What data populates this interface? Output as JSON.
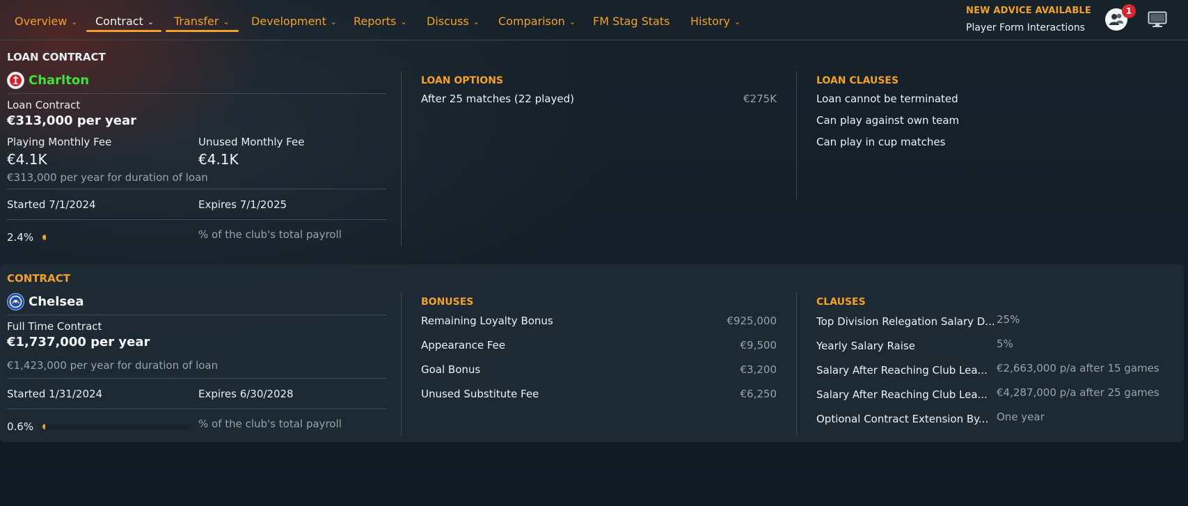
{
  "nav": {
    "items": [
      {
        "label": "Overview",
        "chevron": true
      },
      {
        "label": "Contract",
        "chevron": true
      },
      {
        "label": "Transfer",
        "chevron": true
      },
      {
        "label": "Development",
        "chevron": true
      },
      {
        "label": "Reports",
        "chevron": true
      },
      {
        "label": "Discuss",
        "chevron": true
      },
      {
        "label": "Comparison",
        "chevron": true
      },
      {
        "label": "FM Stag Stats",
        "chevron": false
      },
      {
        "label": "History",
        "chevron": true
      }
    ],
    "active": "Contract"
  },
  "advice": {
    "title": "NEW ADVICE AVAILABLE",
    "subtitle": "Player Form Interactions",
    "badge_count": "1"
  },
  "loan": {
    "section_title": "LOAN CONTRACT",
    "club": "Charlton",
    "contract_type": "Loan Contract",
    "salary": "€313,000 per year",
    "playing_fee_label": "Playing Monthly Fee",
    "playing_fee_value": "€4.1K",
    "unused_fee_label": "Unused Monthly Fee",
    "unused_fee_value": "€4.1K",
    "duration_note": "€313,000 per year for duration of loan",
    "started": "Started 7/1/2024",
    "expires": "Expires 7/1/2025",
    "payroll_pct": "2.4%",
    "payroll_fraction": 0.024,
    "payroll_label": "% of the club's total payroll",
    "options_title": "LOAN OPTIONS",
    "options": [
      {
        "label": "After 25 matches (22 played)",
        "value": "€275K"
      }
    ],
    "clauses_title": "LOAN CLAUSES",
    "clauses": [
      "Loan cannot be terminated",
      "Can play against own team",
      "Can play in cup matches"
    ]
  },
  "contract": {
    "section_title": "CONTRACT",
    "club": "Chelsea",
    "contract_type": "Full Time Contract",
    "salary": "€1,737,000 per year",
    "duration_note": "€1,423,000 per year for duration of loan",
    "started": "Started 1/31/2024",
    "expires": "Expires 6/30/2028",
    "payroll_pct": "0.6%",
    "payroll_fraction": 0.006,
    "payroll_label": "% of the club's total payroll",
    "bonuses_title": "BONUSES",
    "bonuses": [
      {
        "label": "Remaining Loyalty Bonus",
        "value": "€925,000"
      },
      {
        "label": "Appearance Fee",
        "value": "€9,500"
      },
      {
        "label": "Goal Bonus",
        "value": "€3,200"
      },
      {
        "label": "Unused Substitute Fee",
        "value": "€6,250"
      }
    ],
    "clauses_title": "CLAUSES",
    "clauses": [
      {
        "label": "Top Division Relegation Salary D...",
        "value": "25%"
      },
      {
        "label": "Yearly Salary Raise",
        "value": "5%"
      },
      {
        "label": "Salary After Reaching Club Lea...",
        "value": "€2,663,000 p/a after 15 games"
      },
      {
        "label": "Salary After Reaching Club Lea...",
        "value": "€4,287,000 p/a after 25 games"
      },
      {
        "label": "Optional Contract Extension By...",
        "value": "One year"
      }
    ]
  },
  "colors": {
    "accent": "#f2a22a",
    "charlton_green": "#3fe23b",
    "muted": "#98a4ad"
  }
}
